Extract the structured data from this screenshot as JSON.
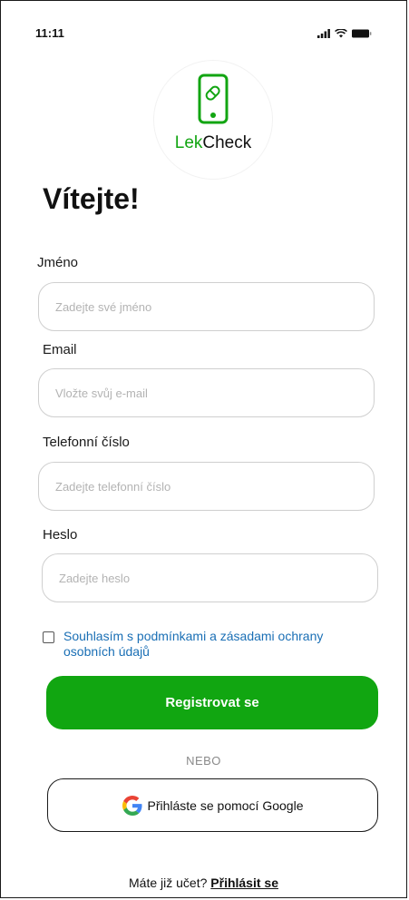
{
  "status_bar": {
    "time": "11:11",
    "icons": [
      "signal-icon",
      "wifi-icon",
      "battery-icon"
    ]
  },
  "logo": {
    "icon": "phone-pill-icon",
    "text_accent": "Lek",
    "text_rest": "Check"
  },
  "title": "Vítejte!",
  "form": {
    "name": {
      "label": "Jméno",
      "placeholder": "Zadejte své jméno"
    },
    "email": {
      "label": "Email",
      "placeholder": "Vložte svůj e-mail"
    },
    "phone": {
      "label": "Telefonní číslo",
      "placeholder": "Zadejte telefonní číslo"
    },
    "password": {
      "label": "Heslo",
      "placeholder": "Zadejte heslo"
    }
  },
  "consent": {
    "checked": false,
    "text": "Souhlasím s podmínkami a zásadami ochrany osobních údajů"
  },
  "register_button": "Registrovat se",
  "divider": "NEBO",
  "google_button": {
    "icon": "google-icon",
    "label": "Přihláste se pomocí Google"
  },
  "footer": {
    "prompt": "Máte již učet?",
    "link": "Přihlásit se"
  },
  "colors": {
    "accent": "#11a611",
    "consent_link": "#1a6fb5",
    "input_border": "#cfcfcf"
  }
}
